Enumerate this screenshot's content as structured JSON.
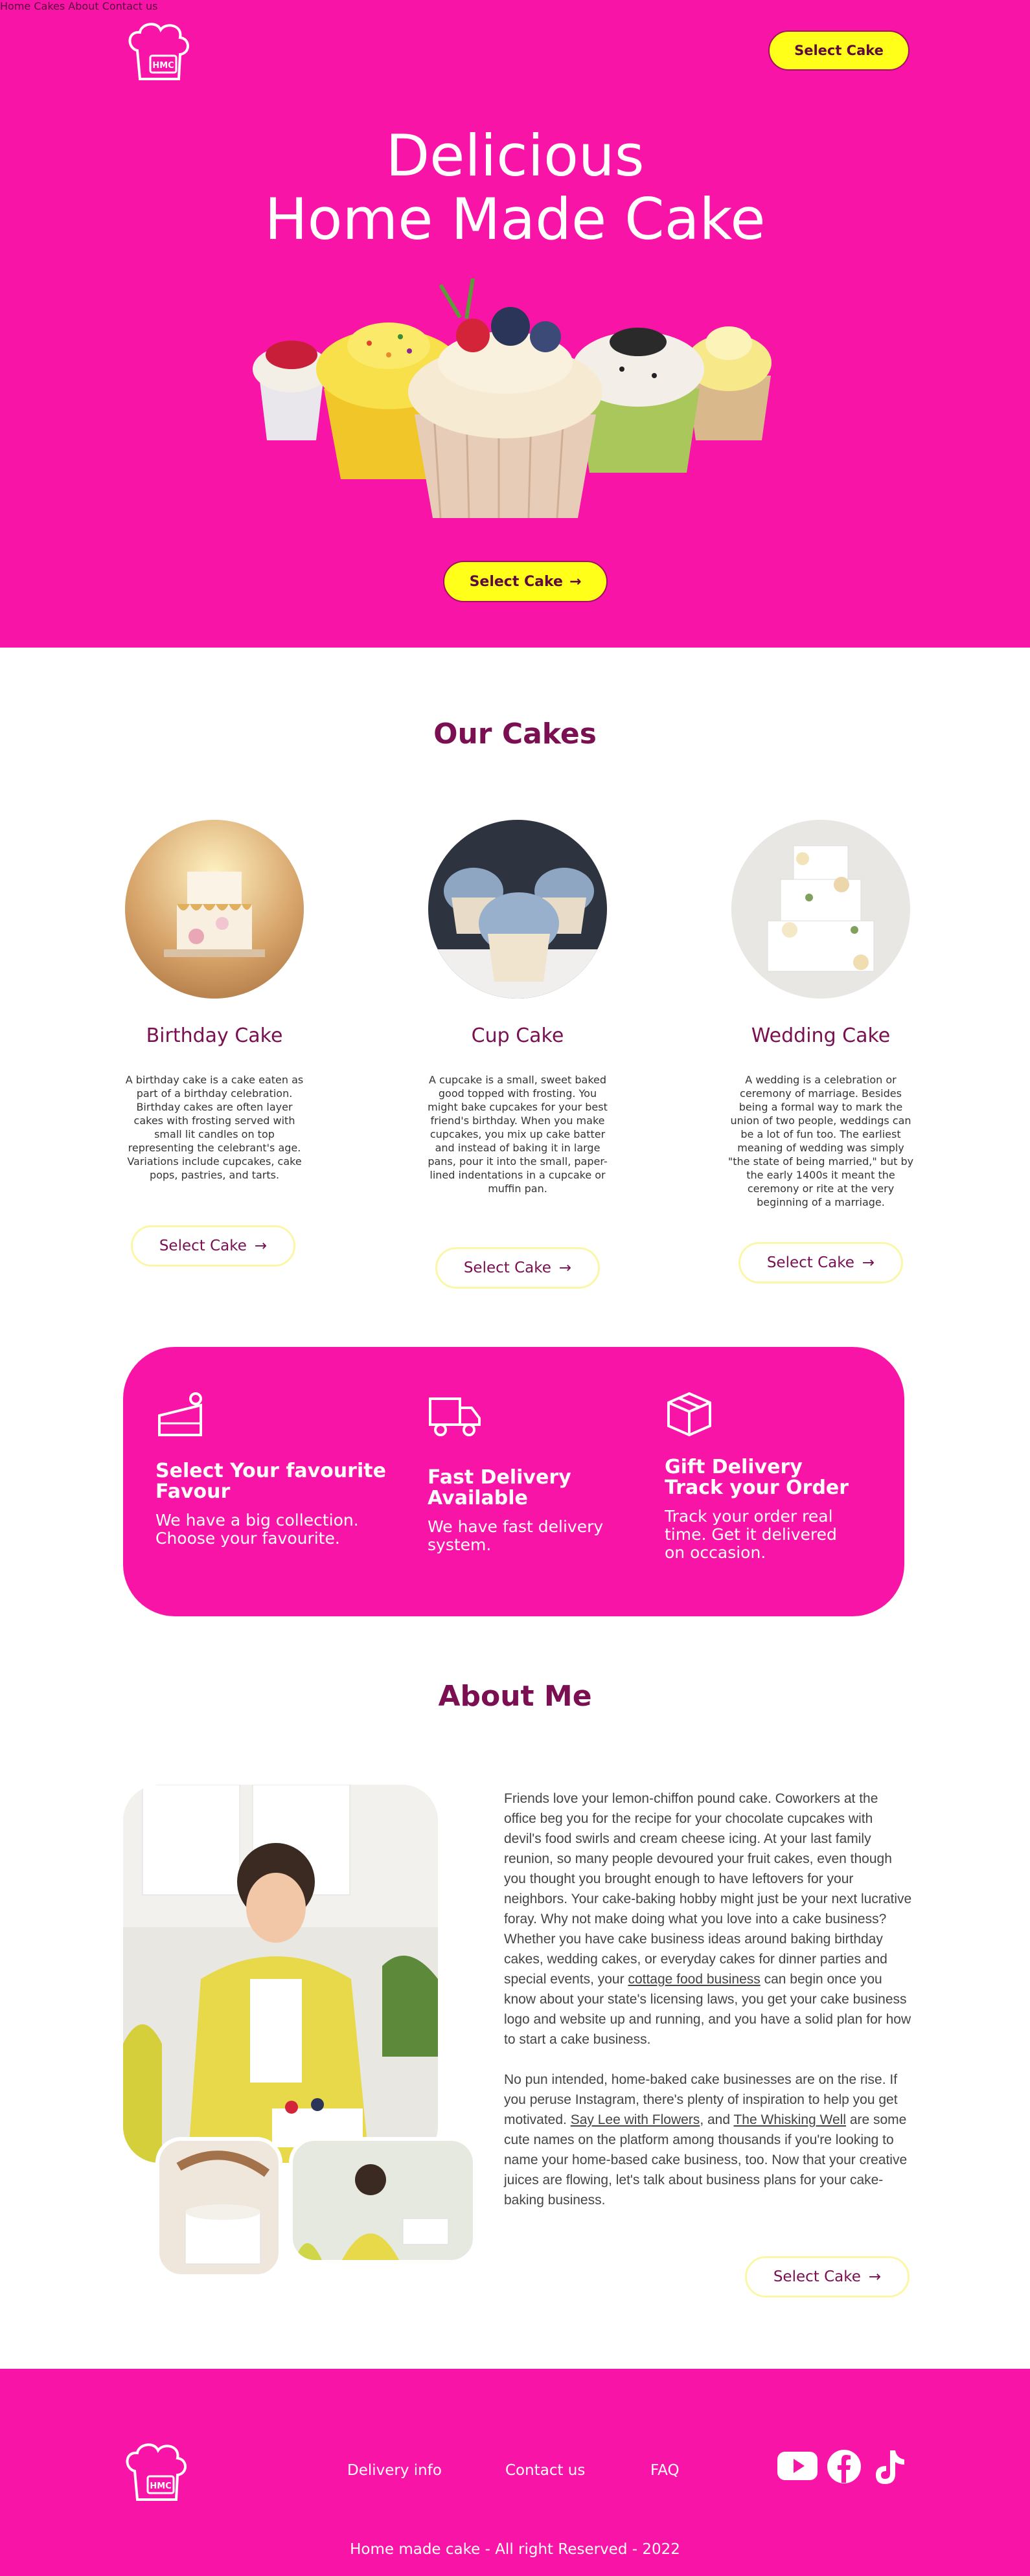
{
  "header": {
    "logo_text": "HMC",
    "nav": [
      "Home",
      "Cakes",
      "About",
      "Contact us"
    ],
    "cta_label": "Select  Cake"
  },
  "hero": {
    "title_line1": "Delicious",
    "title_line2": "Home Made Cake",
    "cta_label": "Select  Cake"
  },
  "cakes": {
    "title": "Our Cakes",
    "items": [
      {
        "name": "Birthday Cake",
        "description": "A birthday cake is a cake eaten as part of a birthday celebration. Birthday cakes are often layer cakes with frosting served with small lit candles on top representing the celebrant's age. Variations include cupcakes, cake pops, pastries, and tarts.",
        "cta": "Select  Cake"
      },
      {
        "name": "Cup Cake",
        "description": "A cupcake is a small, sweet baked good topped with frosting. You might bake cupcakes for your best friend's birthday. When you make cupcakes, you mix up cake batter and instead of baking it in large pans, pour it into the small, paper-lined indentations in a cupcake or muffin pan.",
        "cta": "Select  Cake"
      },
      {
        "name": "Wedding Cake",
        "description": "A wedding is a celebration or ceremony of marriage. Besides being a formal way to mark the union of two people, weddings can be a lot of fun too. The earliest meaning of wedding was simply \"the state of being married,\" but by the early 1400s it meant the ceremony or rite at the very beginning of a marriage.",
        "cta": "Select  Cake"
      }
    ]
  },
  "features": [
    {
      "title": "Select Your favourite Favour",
      "text": "We have a big collection. Choose your favourite."
    },
    {
      "title": "Fast Delivery Available",
      "text": "We have fast delivery system."
    },
    {
      "title": "Gift Delivery Track your Order",
      "text": "Track your order real time. Get it delivered on occasion."
    }
  ],
  "about": {
    "title": "About Me",
    "p1_a": "Friends love your lemon-chiffon pound cake. Coworkers at the office beg you for the recipe for your chocolate cupcakes with devil's food swirls and cream cheese icing. At your last family reunion, so many people devoured your fruit cakes, even though you thought you brought enough to have leftovers for your neighbors. Your cake-baking hobby might just be your next lucrative foray. Why not make doing what you love into a cake business? Whether you have cake business ideas around baking birthday cakes, wedding cakes, or everyday cakes for dinner parties and special events, your ",
    "p1_link": "cottage food business",
    "p1_b": " can begin once you know about your state's licensing laws, you get your cake business logo and website up and running, and you have a solid plan for how to start a cake business.",
    "p2_a": "No pun intended, home-baked cake businesses are on the rise. If you peruse Instagram, there's plenty of inspiration to help you get motivated. ",
    "p2_link1": "Say Lee with Flowers",
    "p2_mid": ", and ",
    "p2_link2": "The Whisking Well",
    "p2_b": " are some cute names on the platform among thousands if you're looking to name your home-based cake business, too. Now that your creative juices are flowing, let's talk about business plans for your cake-baking business.",
    "cta": "Select  Cake"
  },
  "footer": {
    "logo_text": "HMC",
    "links": [
      "Delivery info",
      "Contact us",
      "FAQ"
    ],
    "copyright": "Home made cake - All right Reserved - 2022"
  },
  "colors": {
    "pink": "#f714a7",
    "yellow": "#ffff1a",
    "maroon": "#7a0f52"
  }
}
